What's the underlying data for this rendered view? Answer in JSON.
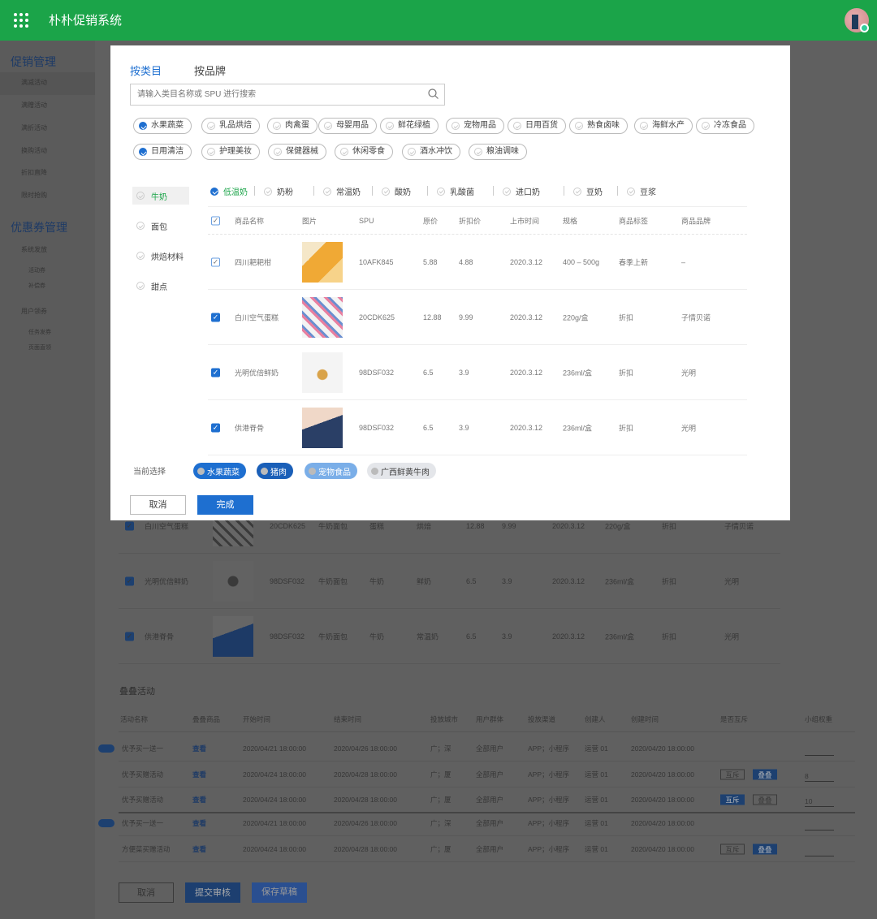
{
  "header": {
    "title": "朴朴促销系统",
    "avatar_icon": "user-avatar",
    "accent": "#1ba449"
  },
  "sidebar": {
    "groups": [
      {
        "title": "促销管理",
        "items": [
          "满减活动",
          "满赠活动",
          "满折活动",
          "换购活动",
          "折扣直降",
          "限时抢购"
        ],
        "active": "满减活动"
      },
      {
        "title": "优惠券管理",
        "items": [
          "系统发放",
          "用户领券"
        ],
        "subitems": {
          "系统发放": [
            "活动券",
            "补偿券"
          ],
          "用户领券": [
            "任务发券",
            "页面直领"
          ]
        }
      }
    ]
  },
  "background_products": [
    {
      "name": "白川空气蛋糕",
      "spu": "20CDK625",
      "c1": "牛奶面包",
      "c2": "蛋糕",
      "c3": "烘焙",
      "price": "12.88",
      "discount": "9.99",
      "date": "2020.3.12",
      "spec": "220g/盒",
      "tag": "折扣",
      "brand": "子情贝诺"
    },
    {
      "name": "光明优倍鲜奶",
      "spu": "98DSF032",
      "c1": "牛奶面包",
      "c2": "牛奶",
      "c3": "鲜奶",
      "price": "6.5",
      "discount": "3.9",
      "date": "2020.3.12",
      "spec": "236ml/盒",
      "tag": "折扣",
      "brand": "光明"
    },
    {
      "name": "供港脊骨",
      "spu": "98DSF032",
      "c1": "牛奶面包",
      "c2": "牛奶",
      "c3": "常温奶",
      "price": "6.5",
      "discount": "3.9",
      "date": "2020.3.12",
      "spec": "236ml/盒",
      "tag": "折扣",
      "brand": "光明"
    }
  ],
  "overlap": {
    "title": "叠叠活动",
    "columns": [
      "活动名称",
      "叠叠商品",
      "开始时间",
      "结束时间",
      "投放城市",
      "用户群体",
      "投放渠道",
      "创建人",
      "创建时间",
      "是否互斥",
      "小组权重"
    ],
    "rows": [
      {
        "name": "优予买一送一",
        "view": "查看",
        "start": "2020/04/21 18:00:00",
        "end": "2020/04/26 18:00:00",
        "city": "广；深",
        "group": "全部用户",
        "channel": "APP；小程序",
        "creator": "运营 01",
        "created": "2020/04/20 18:00:00",
        "mutex": null,
        "weight": "",
        "badge": true
      },
      {
        "name": "优予买赠活动",
        "view": "查看",
        "start": "2020/04/24 18:00:00",
        "end": "2020/04/28 18:00:00",
        "city": "广；厦",
        "group": "全部用户",
        "channel": "APP；小程序",
        "creator": "运营 01",
        "created": "2020/04/20 18:00:00",
        "mutex": [
          "互斥",
          "叠叠"
        ],
        "mutex_on": 1,
        "weight": "8",
        "badge": false
      },
      {
        "name": "优予买赠活动",
        "view": "查看",
        "start": "2020/04/24 18:00:00",
        "end": "2020/04/28 18:00:00",
        "city": "广；厦",
        "group": "全部用户",
        "channel": "APP；小程序",
        "creator": "运营 01",
        "created": "2020/04/20 18:00:00",
        "mutex": [
          "互斥",
          "叠叠"
        ],
        "mutex_on": 0,
        "weight": "10",
        "badge": false
      },
      {
        "name": "优予买一送一",
        "view": "查看",
        "start": "2020/04/21 18:00:00",
        "end": "2020/04/26 18:00:00",
        "city": "广；深",
        "group": "全部用户",
        "channel": "APP；小程序",
        "creator": "运营 01",
        "created": "2020/04/20 18:00:00",
        "mutex": null,
        "weight": "",
        "badge": true
      },
      {
        "name": "方便菜买赠活动",
        "view": "查看",
        "start": "2020/04/24 18:00:00",
        "end": "2020/04/28 18:00:00",
        "city": "广；厦",
        "group": "全部用户",
        "channel": "APP；小程序",
        "creator": "运营 01",
        "created": "2020/04/20 18:00:00",
        "mutex": [
          "互斥",
          "叠叠"
        ],
        "mutex_on": 1,
        "weight": "",
        "badge": false
      }
    ],
    "buttons": {
      "cancel": "取消",
      "submit": "提交审核",
      "save": "保存草稿"
    }
  },
  "modal": {
    "tabs": [
      {
        "label": "按类目",
        "active": true
      },
      {
        "label": "按品牌",
        "active": false
      }
    ],
    "search_placeholder": "请输入类目名称或 SPU 进行搜索",
    "categories": [
      {
        "label": "水果蔬菜",
        "checked": true
      },
      {
        "label": "乳品烘焙",
        "checked": false
      },
      {
        "label": "肉禽蛋",
        "checked": false
      },
      {
        "label": "母婴用品",
        "checked": false
      },
      {
        "label": "鲜花绿植",
        "checked": false
      },
      {
        "label": "宠物用品",
        "checked": false
      },
      {
        "label": "日用百货",
        "checked": false
      },
      {
        "label": "熟食卤味",
        "checked": false
      },
      {
        "label": "海鲜水产",
        "checked": false
      },
      {
        "label": "冷冻食品",
        "checked": false
      },
      {
        "label": "日用清洁",
        "checked": true
      },
      {
        "label": "护理美妆",
        "checked": false
      },
      {
        "label": "保健器械",
        "checked": false
      },
      {
        "label": "休闲零食",
        "checked": false
      },
      {
        "label": "酒水冲饮",
        "checked": false
      },
      {
        "label": "粮油调味",
        "checked": false
      }
    ],
    "left_categories": [
      {
        "label": "牛奶",
        "active": true
      },
      {
        "label": "面包",
        "active": false
      },
      {
        "label": "烘焙材料",
        "active": false
      },
      {
        "label": "甜点",
        "active": false
      }
    ],
    "subcategories": [
      {
        "label": "低温奶",
        "checked": true
      },
      {
        "label": "奶粉"
      },
      {
        "label": "常温奶"
      },
      {
        "label": "酸奶"
      },
      {
        "label": "乳酸菌"
      },
      {
        "label": "进口奶"
      },
      {
        "label": "豆奶"
      },
      {
        "label": "豆浆"
      }
    ],
    "columns": [
      "商品名称",
      "图片",
      "SPU",
      "原价",
      "折扣价",
      "上市时间",
      "规格",
      "商品标签",
      "商品品牌"
    ],
    "products": [
      {
        "name": "四川耙耙柑",
        "spu": "10AFK845",
        "price": "5.88",
        "discount": "4.88",
        "date": "2020.3.12",
        "spec": "400 – 500g",
        "tag": "春季上新",
        "brand": "–",
        "checked": false,
        "image": "orange-illustration"
      },
      {
        "name": "白川空气蛋糕",
        "spu": "20CDK625",
        "price": "12.88",
        "discount": "9.99",
        "date": "2020.3.12",
        "spec": "220g/盒",
        "tag": "折扣",
        "brand": "子情贝诺",
        "checked": true,
        "image": "cake-illustration"
      },
      {
        "name": "光明优倍鲜奶",
        "spu": "98DSF032",
        "price": "6.5",
        "discount": "3.9",
        "date": "2020.3.12",
        "spec": "236ml/盒",
        "tag": "折扣",
        "brand": "光明",
        "checked": true,
        "image": "milk-glasses-illustration"
      },
      {
        "name": "供港脊骨",
        "spu": "98DSF032",
        "price": "6.5",
        "discount": "3.9",
        "date": "2020.3.12",
        "spec": "236ml/盒",
        "tag": "折扣",
        "brand": "光明",
        "checked": true,
        "image": "mountain-illustration"
      }
    ],
    "selection_label": "当前选择",
    "selected": [
      {
        "label": "水果蔬菜",
        "color": "#1e6fd0"
      },
      {
        "label": "猪肉",
        "color": "#1a5fb8"
      },
      {
        "label": "宠物食品",
        "color": "#7aaee8"
      },
      {
        "label": "广西鲜黄牛肉",
        "color": "#e4e6ea"
      }
    ],
    "cancel": "取消",
    "done": "完成",
    "primary": "#1e6fd0"
  }
}
